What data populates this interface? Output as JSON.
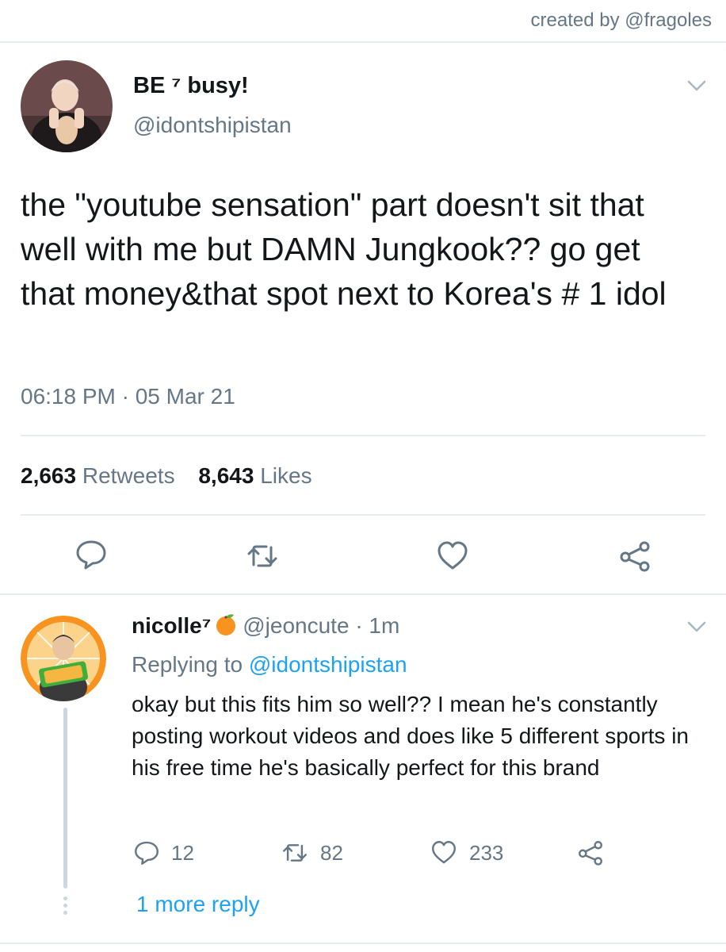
{
  "credit": "created by @fragoles",
  "tweet": {
    "display_name": "BE ⁷ busy!",
    "handle": "@idontshipistan",
    "text": "the \"youtube sensation\" part doesn't sit that well with me but DAMN Jungkook?? go get that money&that spot next to Korea's # 1 idol",
    "timestamp": "06:18 PM · 05 Mar 21",
    "retweets_count": "2,663",
    "retweets_label": "Retweets",
    "likes_count": "8,643",
    "likes_label": "Likes"
  },
  "reply": {
    "display_name": "nicolle⁷",
    "handle": "@jeoncute",
    "time": "· 1m",
    "replying_prefix": "Replying to",
    "replying_to": "@idontshipistan",
    "text": "okay but this fits him so well?? I mean he's constantly posting workout videos and does like 5 different sports in his free time he's basically perfect for this brand",
    "replies": "12",
    "retweets": "82",
    "likes": "233",
    "more_replies": "1 more reply"
  },
  "colors": {
    "text": "#14171a",
    "secondary": "#657786",
    "link": "#1da1f2",
    "divider": "#e6ecf0",
    "icon": "#657786"
  },
  "icons": [
    "chevron-down-icon",
    "reply-icon",
    "retweet-icon",
    "like-icon",
    "share-icon",
    "orange-emoji-icon"
  ]
}
